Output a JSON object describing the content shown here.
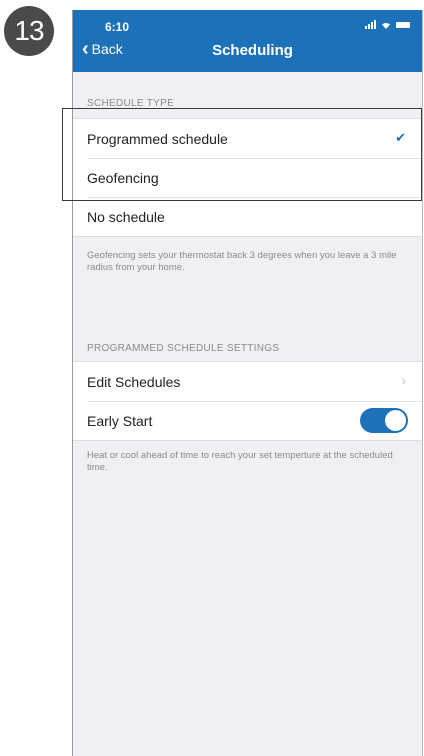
{
  "step": {
    "number": "13"
  },
  "status_bar": {
    "time": "6:10"
  },
  "nav": {
    "back_label": "Back",
    "title": "Scheduling"
  },
  "schedule_type": {
    "header": "SCHEDULE TYPE",
    "options": [
      {
        "label": "Programmed schedule",
        "selected": true
      },
      {
        "label": "Geofencing",
        "selected": false
      },
      {
        "label": "No schedule",
        "selected": false
      }
    ],
    "footnote": "Geofencing sets your thermostat back 3 degrees when you leave a 3 mile radius from your home."
  },
  "programmed_settings": {
    "header": "PROGRAMMED SCHEDULE SETTINGS",
    "edit_schedules_label": "Edit Schedules",
    "early_start_label": "Early Start",
    "early_start_on": true,
    "footnote": "Heat or cool ahead of time to reach your set temperture at the scheduled time."
  },
  "colors": {
    "accent": "#1d71b8",
    "background": "#efeff4"
  }
}
